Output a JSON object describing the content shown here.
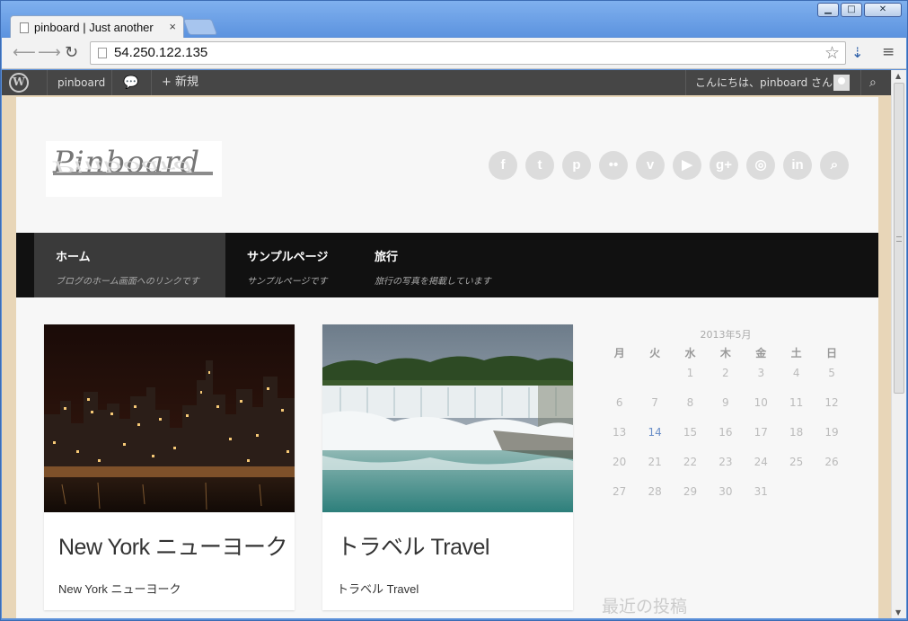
{
  "browser": {
    "tab_title": "pinboard | Just another",
    "tab_close": "×",
    "url": "54.250.122.135",
    "window_buttons": {
      "minimize": "▁",
      "maximize": "□",
      "close": "✕"
    }
  },
  "adminbar": {
    "logo": "W",
    "site": "pinboard",
    "comment_icon": "💬",
    "new": "+ 新規",
    "greeting": "こんにちは、pinboard さん !"
  },
  "site": {
    "logo_text": "Pinboard",
    "social_icons": [
      {
        "name": "facebook-icon",
        "glyph": "f"
      },
      {
        "name": "twitter-icon",
        "glyph": "t"
      },
      {
        "name": "pinterest-icon",
        "glyph": "p"
      },
      {
        "name": "flickr-icon",
        "glyph": "••"
      },
      {
        "name": "vimeo-icon",
        "glyph": "v"
      },
      {
        "name": "youtube-icon",
        "glyph": "▶"
      },
      {
        "name": "google-plus-icon",
        "glyph": "g+"
      },
      {
        "name": "dribbble-icon",
        "glyph": "◎"
      },
      {
        "name": "linkedin-icon",
        "glyph": "in"
      },
      {
        "name": "search-icon",
        "glyph": "⌕"
      }
    ],
    "nav": [
      {
        "title": "ホーム",
        "desc": "ブログのホーム画面へのリンクです"
      },
      {
        "title": "サンプルページ",
        "desc": "サンプルページです"
      },
      {
        "title": "旅行",
        "desc": "旅行の写真を掲載しています"
      }
    ],
    "posts": [
      {
        "title": "New York ニューヨーク",
        "excerpt": "New York ニューヨーク"
      },
      {
        "title": "トラベル Travel",
        "excerpt": "トラベル Travel"
      }
    ],
    "calendar": {
      "caption": "2013年5月",
      "weekdays": [
        "月",
        "火",
        "水",
        "木",
        "金",
        "土",
        "日"
      ],
      "weeks": [
        [
          "",
          "",
          "1",
          "2",
          "3",
          "4",
          "5"
        ],
        [
          "6",
          "7",
          "8",
          "9",
          "10",
          "11",
          "12"
        ],
        [
          "13",
          "14",
          "15",
          "16",
          "17",
          "18",
          "19"
        ],
        [
          "20",
          "21",
          "22",
          "23",
          "24",
          "25",
          "26"
        ],
        [
          "27",
          "28",
          "29",
          "30",
          "31",
          "",
          ""
        ]
      ],
      "today": "14"
    },
    "widget_title": "最近の投稿"
  }
}
